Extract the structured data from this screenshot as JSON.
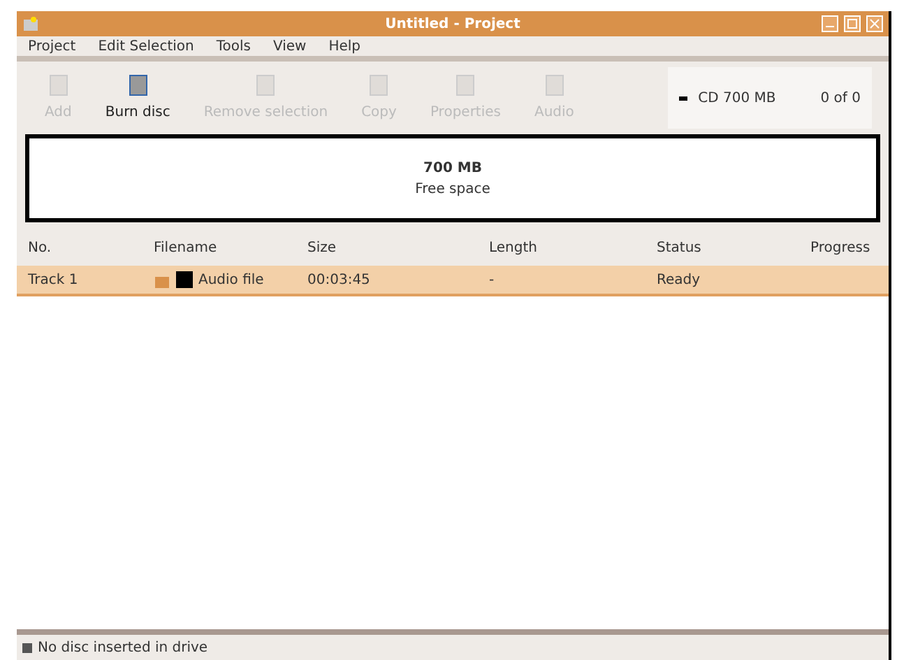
{
  "window": {
    "title": "Untitled - Project"
  },
  "menu": [
    "Project",
    "Edit Selection",
    "Tools",
    "View",
    "Help"
  ],
  "toolbar": [
    {
      "label": "Add",
      "disabled": true
    },
    {
      "label": "Burn disc",
      "disabled": false
    },
    {
      "label": "Remove selection",
      "disabled": true
    },
    {
      "label": "Copy",
      "disabled": true
    },
    {
      "label": "Properties",
      "disabled": true
    },
    {
      "label": "Audio",
      "disabled": true
    }
  ],
  "disc_select": {
    "value": "CD 700 MB",
    "extra": "0 of 0"
  },
  "summary": {
    "line_1": "700 MB",
    "line_2": "Free space"
  },
  "table": {
    "columns": [
      "No.",
      "Filename",
      "Size",
      "Length",
      "Status",
      "Progress"
    ],
    "rows": [
      {
        "selected": true,
        "cells": [
          "Track 1",
          "Audio file",
          "00:03:45",
          "-",
          "Ready"
        ]
      }
    ]
  },
  "status_bar": "No disc inserted in drive"
}
